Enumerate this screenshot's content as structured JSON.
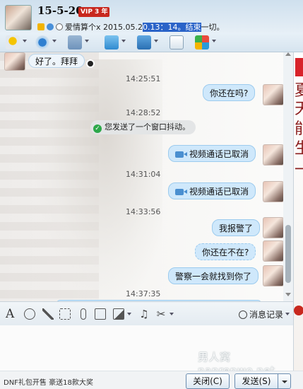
{
  "header": {
    "title": "15-5-20",
    "vip_badge": "VIP 3 年",
    "status_text_a": "爱情算个x 2015.05.2",
    "status_text_highlight": "0.13：14。结束",
    "status_text_b": "一切。"
  },
  "chat": {
    "partner_message": "好了。拜拜",
    "messages": [
      {
        "time": "14:25:51",
        "text": "你还在吗?"
      },
      {
        "time": "14:28:52",
        "system": "您发送了一个窗口抖动。"
      },
      {
        "video": "视频通话已取消"
      },
      {
        "time": "14:31:04",
        "video": "视频通话已取消"
      },
      {
        "time": "14:33:56",
        "text": "我报警了"
      },
      {
        "text": "你还在不在?"
      },
      {
        "text": "警察一会就找到你了"
      },
      {
        "time": "14:37:35"
      }
    ]
  },
  "input_toolbar": {
    "font_glyph": "A",
    "history_label": "消息记录"
  },
  "watermark": "男人窝nanrenwo.net",
  "footer": {
    "promo_text": "DNF礼包开售 豪送18款大奖",
    "close_label": "关闭(C)",
    "send_label": "发送(S)"
  },
  "ad": {
    "chars": [
      "夏",
      "天",
      "能",
      "生",
      "一"
    ]
  },
  "colors": {
    "bubble_bg": "#cfe8fb",
    "bubble_border": "#9ccbee",
    "vip_red": "#c8281e",
    "highlight_blue": "#2a63c8"
  }
}
